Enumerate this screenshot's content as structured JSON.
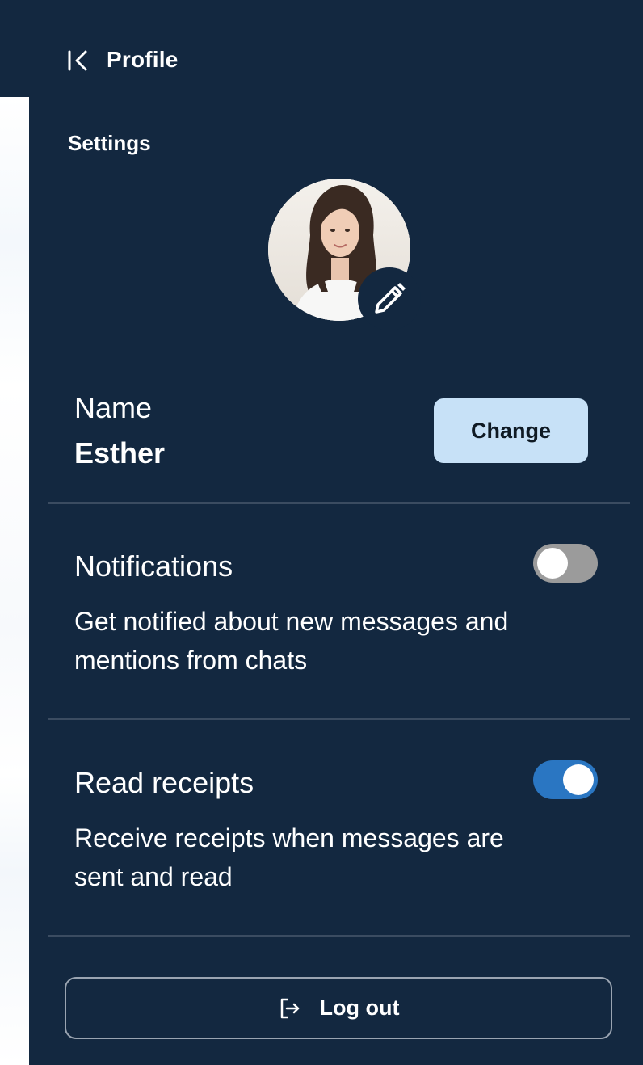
{
  "header": {
    "title": "Profile",
    "back_icon": "collapse-left-icon"
  },
  "settings": {
    "heading": "Settings",
    "avatar_icon": "profile-photo",
    "edit_icon": "pencil-icon"
  },
  "name": {
    "label": "Name",
    "value": "Esther",
    "change_label": "Change"
  },
  "notifications": {
    "title": "Notifications",
    "description": "Get notified about new messages and mentions from chats",
    "enabled": false
  },
  "read_receipts": {
    "title": "Read receipts",
    "description": "Receive receipts when messages are sent and read",
    "enabled": true
  },
  "logout": {
    "label": "Log out",
    "icon": "logout-icon"
  },
  "colors": {
    "panel_bg": "#132840",
    "change_button_bg": "#c7e1f7",
    "toggle_on": "#2a76c2",
    "toggle_off": "#9b9b9b",
    "divider": "#3b4c61"
  }
}
